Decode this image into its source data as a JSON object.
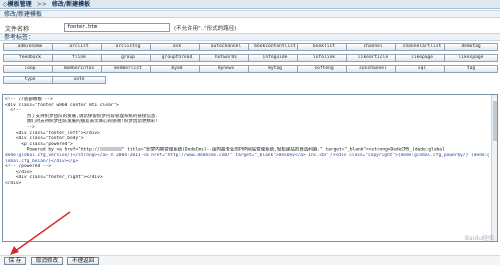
{
  "breadcrumb": {
    "module": "◇模板管理",
    "separator": ">>",
    "page": "修改/新建模板"
  },
  "section_title": "修改/新建模板",
  "file": {
    "label": "文件名称",
    "value": "footer.htm",
    "hint": "(不允许用\"..\"形式的路径)"
  },
  "tags_title": "参考标签：",
  "tag_rows": [
    [
      "adminname",
      "arclist",
      "arclistsg",
      "ask",
      "autochannel",
      "bookcontentlist",
      "booklist",
      "channel",
      "channelartlist",
      "demotag"
    ],
    [
      "feedback",
      "flink",
      "group",
      "groupthread",
      "hotwords",
      "infoguide",
      "infolink",
      "likearticle",
      "likepage",
      "likespage"
    ],
    [
      "loop",
      "memberinfos",
      "memberlist",
      "myad",
      "mynews",
      "mytag",
      "softeng",
      "sonchannel",
      "sql",
      "tag"
    ],
    [
      "type",
      "vote"
    ]
  ],
  "code_lines": [
    "<!-- //底部模板 -->",
    "<div class=\"footer w960 center mt1 clear\">",
    "  <!--",
    "        为了支持织梦团队的发展,请您保留织梦内容管理系统的链接信息.",
    "        我们对支持织梦团队发展的朋友表示真心的感谢!织梦因您更精彩!",
    "        -->",
    "    <div class=\"footer_left\"></div>",
    "    <div class=\"footer_body\">",
    "      <p class=\"powered\">",
    "        Powered by <a href=\"http://",
    "\" title=\"织梦内容管理系统(DedeCms)--国内最专业的PHP网站管理系统,轻松建站的首选利器.\" target=\"_blank\"><strong>DedeCMS_{dede:global",
    "dede:global.cfg_version/}</strong></a> © 2004-2011 <a href=\"http://www.dedecms.com/\" target=\"_blank\">DesDev</a> Inc.<br /><div class=\"copyright\">{dede:global.cfg_powerby/} {dede:g",
    "lobal.cfg_beian/}</div></p>",
    "<!-- /powered -->",
    "    </div>",
    "    <div class=\"footer_right\"></div>",
    "</div>"
  ],
  "actions": {
    "save": "保 存",
    "cancel": "取消修改",
    "back": "不理返回"
  },
  "watermark": "Baidu经验"
}
